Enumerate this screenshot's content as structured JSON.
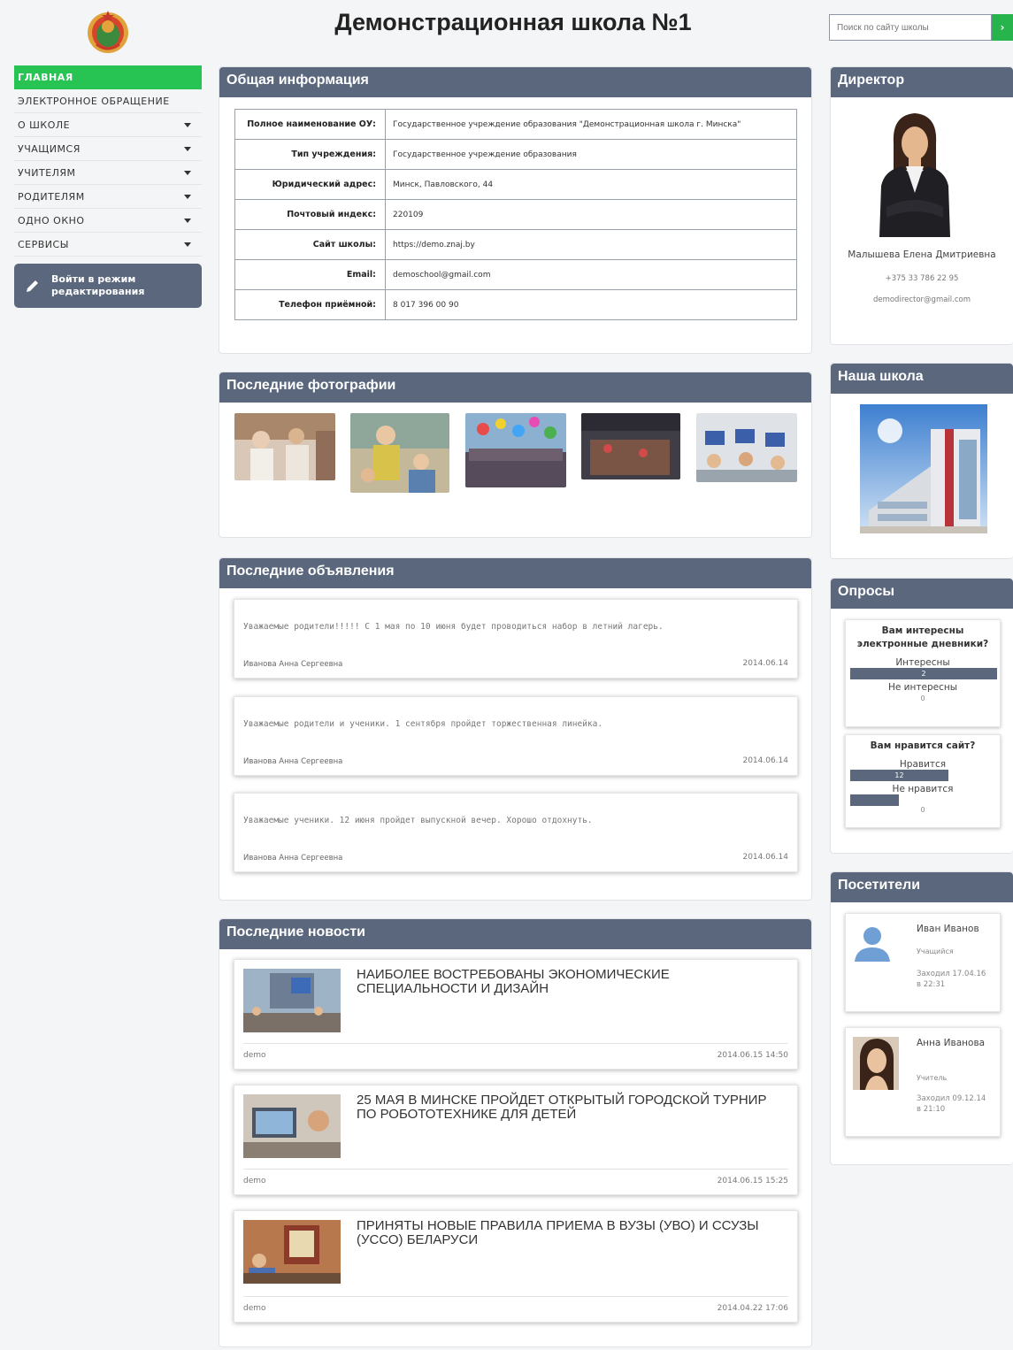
{
  "header": {
    "title": "Демонстрационная школа №1",
    "search_placeholder": "Поиск по сайту школы",
    "search_button": "›"
  },
  "nav": {
    "items": [
      {
        "label": "ГЛАВНАЯ"
      },
      {
        "label": "ЭЛЕКТРОННОЕ ОБРАЩЕНИЕ"
      },
      {
        "label": "О ШКОЛЕ"
      },
      {
        "label": "УЧАЩИМСЯ"
      },
      {
        "label": "УЧИТЕЛЯМ"
      },
      {
        "label": "РОДИТЕЛЯМ"
      },
      {
        "label": "ОДНО ОКНО"
      },
      {
        "label": "СЕРВИСЫ"
      }
    ],
    "edit_button": {
      "line1": "Войти в режим",
      "line2": "редактирования"
    }
  },
  "general_info": {
    "title": "Общая информация",
    "rows": [
      {
        "key": "Полное наименование ОУ:",
        "value": "Государственное учреждение образования \"Демонстрационная школа г. Минска\""
      },
      {
        "key": "Тип учреждения:",
        "value": "Государственное учреждение образования"
      },
      {
        "key": "Юридический адрес:",
        "value": "Минск, Павловского, 44"
      },
      {
        "key": "Почтовый индекс:",
        "value": "220109"
      },
      {
        "key": "Сайт школы:",
        "value": "https://demo.znaj.by"
      },
      {
        "key": "Email:",
        "value": "demoschool@gmail.com"
      },
      {
        "key": "Телефон приёмной:",
        "value": "8 017 396 00 90"
      }
    ]
  },
  "photos": {
    "title": "Последние фотографии"
  },
  "announcements": {
    "title": "Последние объявления",
    "items": [
      {
        "text": "Уважаемые родители!!!!! С 1 мая по 10 июня будет проводиться набор в летний лагерь.",
        "author": "Иванова Анна Сергеевна",
        "date": "2014.06.14"
      },
      {
        "text": "Уважаемые родители и ученики. 1 сентября пройдет торжественная линейка.",
        "author": "Иванова Анна Сергеевна",
        "date": "2014.06.14"
      },
      {
        "text": "Уважаемые ученики. 12 июня пройдет выпускной вечер. Хорошо отдохнуть.",
        "author": "Иванова Анна Сергеевна",
        "date": "2014.06.14"
      }
    ]
  },
  "news": {
    "title": "Последние новости",
    "items": [
      {
        "title": "Наиболее востребованы экономические специальности и дизайн",
        "author": "demo",
        "date": "2014.06.15 14:50"
      },
      {
        "title": "25 мая в Минске пройдет открытый городской турнир по робототехнике для детей",
        "author": "demo",
        "date": "2014.06.15 15:25"
      },
      {
        "title": "Приняты новые правила приема в вузы (УВО) и ссузы (УССО) Беларуси",
        "author": "demo",
        "date": "2014.04.22 17:06"
      }
    ]
  },
  "director": {
    "title": "Директор",
    "name": "Малышева Елена Дмитриевна",
    "phone": "+375 33 786 22 95",
    "email": "demodirector@gmail.com"
  },
  "our_school": {
    "title": "Наша школа"
  },
  "polls": {
    "title": "Опросы",
    "items": [
      {
        "question": "Вам интересны электронные дневники?",
        "options": [
          {
            "label": "Интересны",
            "count": "2",
            "fraction": 1.0
          },
          {
            "label": "Не интересны",
            "count": "0",
            "fraction": 0.0
          }
        ]
      },
      {
        "question": "Вам нравится сайт?",
        "options": [
          {
            "label": "Нравится",
            "count": "12",
            "fraction": 0.67
          },
          {
            "label": "Не нравится",
            "count": "0",
            "fraction": 0.33
          }
        ]
      }
    ]
  },
  "visitors": {
    "title": "Посетители",
    "items": [
      {
        "name": "Иван Иванов",
        "role": "Учащийся",
        "seen_line1": "Заходил 17.04.16",
        "seen_line2": "в 22:31"
      },
      {
        "name": "Анна Иванова",
        "role": "Учитель",
        "seen_line1": "Заходил 09.12.14",
        "seen_line2": "в 21:10"
      }
    ]
  }
}
